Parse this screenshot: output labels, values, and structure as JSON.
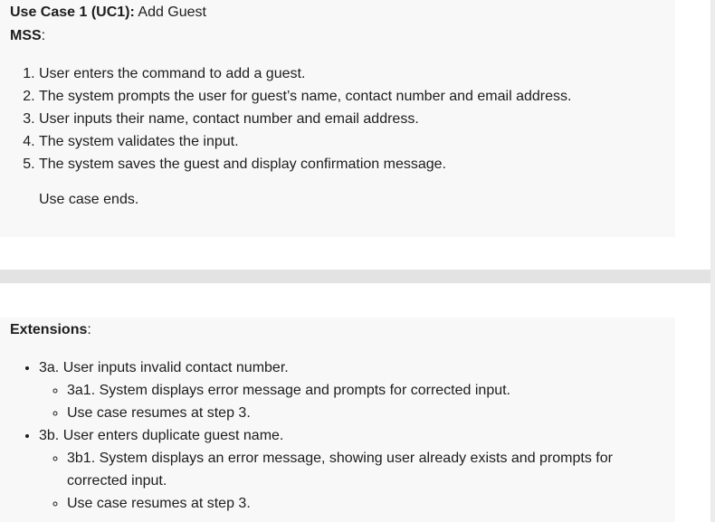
{
  "use_case": {
    "label": "Use Case 1 (UC1)",
    "separator": ":",
    "title": " Add Guest"
  },
  "mss": {
    "label": "MSS",
    "separator": ":",
    "steps": [
      "User enters the command to add a guest.",
      "The system prompts the user for guest’s name, contact number and email address.",
      "User inputs their name, contact number and email address.",
      "The system validates the input.",
      "The system saves the guest and display confirmation message."
    ],
    "ending": "Use case ends."
  },
  "extensions": {
    "label": "Extensions",
    "separator": ":",
    "items": [
      {
        "text": "3a. User inputs invalid contact number.",
        "sub": [
          "3a1. System displays error message and prompts for corrected input.",
          "Use case resumes at step 3."
        ]
      },
      {
        "text": "3b. User enters duplicate guest name.",
        "sub": [
          "3b1. System displays an error message, showing user already exists and prompts for corrected input.",
          "Use case resumes at step 3."
        ]
      }
    ]
  }
}
